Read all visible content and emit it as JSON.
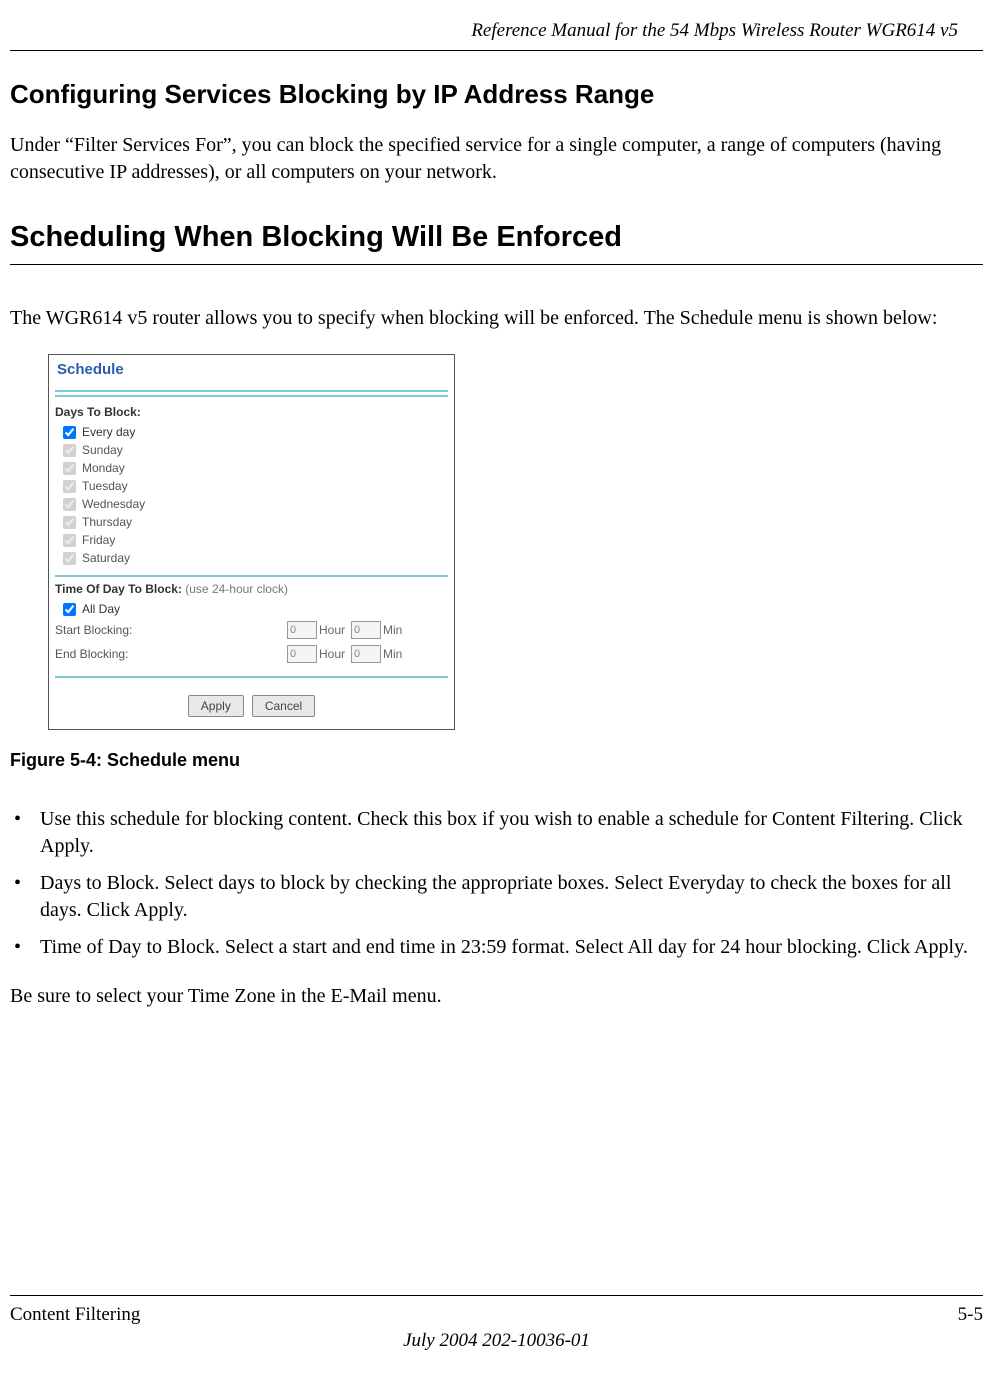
{
  "header": {
    "title": "Reference Manual for the 54 Mbps Wireless Router WGR614 v5"
  },
  "sections": {
    "config_title": "Configuring Services Blocking by IP Address Range",
    "config_body": "Under “Filter Services For”, you can block the specified service for a single computer, a range of computers (having consecutive IP addresses), or all computers on your network.",
    "schedule_title": "Scheduling When Blocking Will Be Enforced",
    "schedule_intro": "The WGR614 v5 router allows you to specify when blocking will be enforced. The Schedule menu is shown below:"
  },
  "screenshot": {
    "panel_title": "Schedule",
    "days_label": "Days To Block:",
    "days": [
      {
        "label": "Every day",
        "checked": true
      },
      {
        "label": "Sunday",
        "checked": false
      },
      {
        "label": "Monday",
        "checked": false
      },
      {
        "label": "Tuesday",
        "checked": false
      },
      {
        "label": "Wednesday",
        "checked": false
      },
      {
        "label": "Thursday",
        "checked": false
      },
      {
        "label": "Friday",
        "checked": false
      },
      {
        "label": "Saturday",
        "checked": false
      }
    ],
    "time_label": "Time Of Day To Block:",
    "time_hint": "(use 24-hour clock)",
    "all_day_label": "All Day",
    "all_day_checked": true,
    "start_label": "Start Blocking:",
    "end_label": "End Blocking:",
    "hour_unit": "Hour",
    "min_unit": "Min",
    "start_hour": "0",
    "start_min": "0",
    "end_hour": "0",
    "end_min": "0",
    "apply_label": "Apply",
    "cancel_label": "Cancel"
  },
  "figure_caption": "Figure 5-4:  Schedule menu",
  "bullets": [
    "Use this schedule for blocking content. Check this box if you wish to enable a schedule for Content Filtering. Click Apply.",
    "Days to Block. Select days to block by checking the appropriate boxes. Select Everyday to check the boxes for all days. Click Apply.",
    "Time of Day to Block. Select a start and end time in 23:59 format. Select All day for 24 hour blocking. Click Apply."
  ],
  "closing_text": "Be sure to select your Time Zone in the E-Mail menu.",
  "footer": {
    "left": "Content Filtering",
    "right": "5-5",
    "center": "July 2004 202-10036-01"
  }
}
